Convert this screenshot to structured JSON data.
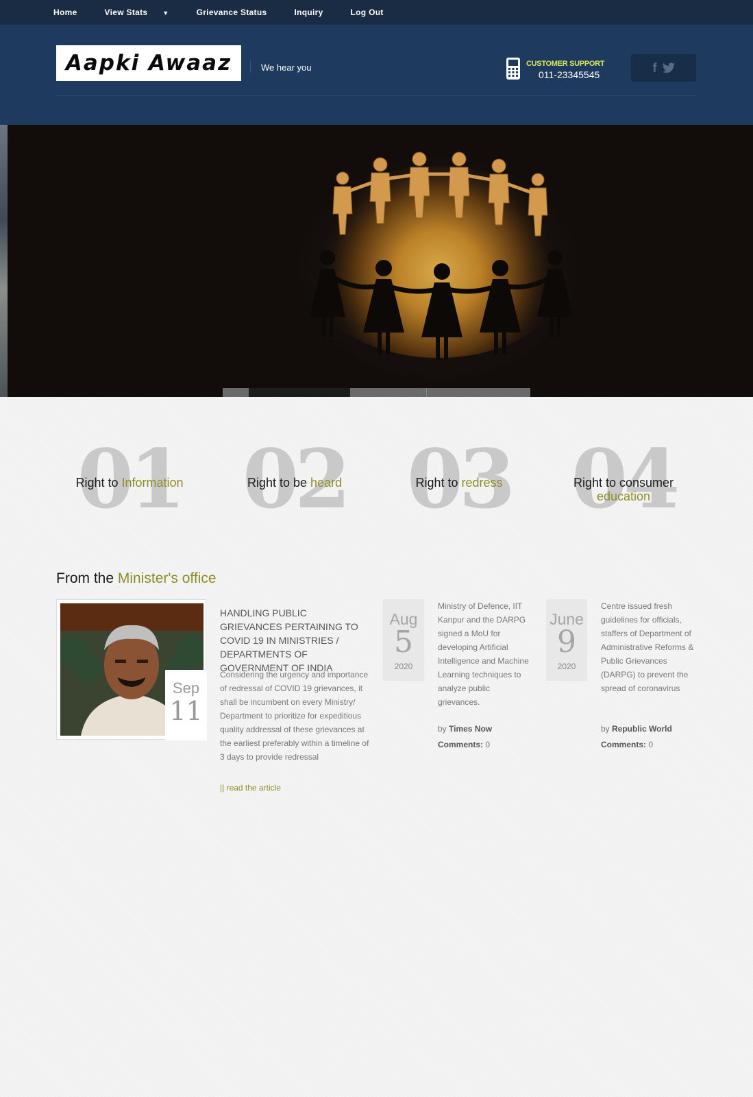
{
  "nav": {
    "items": [
      {
        "label": "Home",
        "has_caret": false
      },
      {
        "label": "View Stats",
        "has_caret": true
      },
      {
        "label": "Grievance Status",
        "has_caret": false
      },
      {
        "label": "Inquiry",
        "has_caret": false
      },
      {
        "label": "Log Out",
        "has_caret": false
      }
    ]
  },
  "header": {
    "logo": "Aapki Awaaz",
    "tagline": "We hear you",
    "support_label": "CUSTOMER SUPPORT",
    "support_phone": "011-23345545",
    "social_icons": [
      "facebook-icon",
      "twitter-icon"
    ],
    "facebook_glyph": "f",
    "twitter_glyph": "t"
  },
  "hero": {
    "slide_count": 4,
    "active_slide": 2
  },
  "rights": [
    {
      "num": "01",
      "prefix": "Right to ",
      "accent": "Information"
    },
    {
      "num": "02",
      "prefix": "Right to be ",
      "accent": "heard"
    },
    {
      "num": "03",
      "prefix": "Right to ",
      "accent": "redress"
    },
    {
      "num": "04",
      "prefix": "Right to consumer ",
      "accent": "education"
    }
  ],
  "minister": {
    "title_prefix": "From the ",
    "title_accent": "Minister's office",
    "featured": {
      "month": "Sep",
      "day": "11",
      "title": "HANDLING PUBLIC GRIEVANCES PERTAINING TO COVID 19 IN MINISTRIES / DEPARTMENTS OF GOVERNMENT OF INDIA",
      "body": "Considering the urgency and importance of redressal of COVID 19 grievances, it shall be incumbent on every Ministry/ Department to prioritize for expeditious quality addressal of these grievances at the earliest preferably within a timeline of 3 days to provide redressal",
      "read_more": "|| read the article"
    },
    "news": [
      {
        "month": "Aug",
        "day": "5",
        "year": "2020",
        "text": "Ministry of Defence, IIT Kanpur and the DARPG signed a MoU for developing Artificial Intelligence and Machine Learning techniques to analyze public grievances.",
        "by_label": "by ",
        "source": "Times Now",
        "comments_label": "Comments:",
        "comments": "0"
      },
      {
        "month": "June",
        "day": "9",
        "year": "2020",
        "text": "Centre issued fresh guidelines for officials, staffers of Department of Administrative Reforms & Public Grievances (DARPG) to prevent the spread of coronavirus",
        "by_label": "by ",
        "source": "Republic World",
        "comments_label": "Comments:",
        "comments": "0"
      }
    ]
  },
  "colors": {
    "nav_bg": "#1a2c44",
    "header_bg": "#1e3a5f",
    "accent": "#8e8b25",
    "support_label": "#d9e85b"
  }
}
